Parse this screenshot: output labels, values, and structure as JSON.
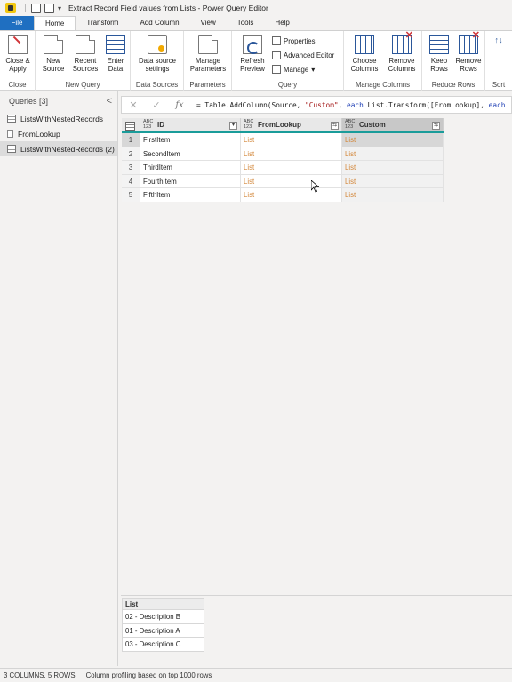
{
  "window": {
    "title": "Extract Record Field values from Lists - Power Query Editor"
  },
  "ribbon_tabs": [
    "File",
    "Home",
    "Transform",
    "Add Column",
    "View",
    "Tools",
    "Help"
  ],
  "ribbon": {
    "close_group": {
      "label": "Close",
      "close_apply": "Close &",
      "close_apply2": "Apply"
    },
    "new_query_group": {
      "label": "New Query",
      "new_source": "New",
      "new_source2": "Source",
      "recent_sources": "Recent",
      "recent_sources2": "Sources",
      "enter_data": "Enter",
      "enter_data2": "Data"
    },
    "data_sources_group": {
      "label": "Data Sources",
      "settings": "Data source",
      "settings2": "settings"
    },
    "parameters_group": {
      "label": "Parameters",
      "manage": "Manage",
      "manage2": "Parameters"
    },
    "query_group": {
      "label": "Query",
      "refresh": "Refresh",
      "refresh2": "Preview",
      "properties": "Properties",
      "advanced_editor": "Advanced Editor",
      "manage": "Manage"
    },
    "manage_columns_group": {
      "label": "Manage Columns",
      "choose": "Choose",
      "choose2": "Columns",
      "remove": "Remove",
      "remove2": "Columns"
    },
    "reduce_rows_group": {
      "label": "Reduce Rows",
      "keep": "Keep",
      "keep2": "Rows",
      "remove": "Remove",
      "remove2": "Rows"
    },
    "sort_group": {
      "label": "Sort"
    }
  },
  "queries_pane": {
    "header": "Queries [3]",
    "collapse_glyph": "<",
    "items": [
      "ListsWithNestedRecords",
      "FromLookup",
      "ListsWithNestedRecords (2)"
    ]
  },
  "formula_bar": {
    "fx": "fx",
    "p1": "= Table.AddColumn(Source, ",
    "p2": "\"Custom\"",
    "p3": ", ",
    "p4": "each",
    "p5": " List.Transform([FromLookup], ",
    "p6": "each"
  },
  "grid": {
    "type_label_top": "ABC",
    "type_label_bottom": "123",
    "columns": [
      "ID",
      "FromLookup",
      "Custom"
    ],
    "rows": [
      {
        "num": "1",
        "id": "FirstItem",
        "lookup": "List",
        "custom": "List"
      },
      {
        "num": "2",
        "id": "SecondItem",
        "lookup": "List",
        "custom": "List"
      },
      {
        "num": "3",
        "id": "ThirdItem",
        "lookup": "List",
        "custom": "List"
      },
      {
        "num": "4",
        "id": "FourthItem",
        "lookup": "List",
        "custom": "List"
      },
      {
        "num": "5",
        "id": "FifthItem",
        "lookup": "List",
        "custom": "List"
      }
    ]
  },
  "preview": {
    "header": "List",
    "items": [
      "02 - Description B",
      "01 - Description A",
      "03 - Description C"
    ]
  },
  "status": {
    "summary": "3 COLUMNS, 5 ROWS",
    "profiling": "Column profiling based on top 1000 rows"
  },
  "colors": {
    "file_tab": "#1f6fc1",
    "header_accent": "#1a9c9a",
    "link": "#d3873a"
  }
}
